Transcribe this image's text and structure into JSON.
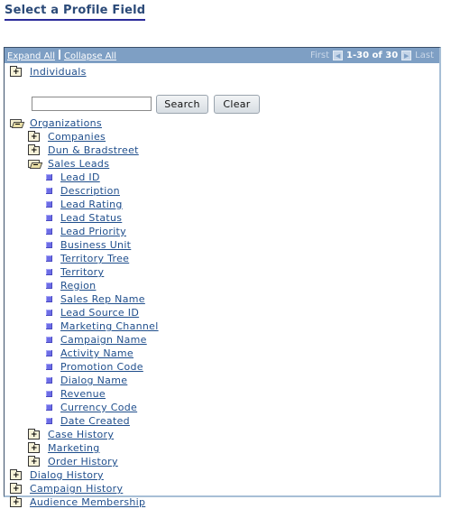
{
  "page": {
    "title": "Select a Profile Field"
  },
  "navbar": {
    "expand_all": "Expand All",
    "collapse_all": "Collapse All",
    "first": "First",
    "last": "Last",
    "count": "1-30 of 30"
  },
  "search": {
    "value": "",
    "placeholder": "",
    "search_label": "Search",
    "clear_label": "Clear"
  },
  "tree": {
    "individuals": "Individuals",
    "organizations": "Organizations",
    "companies": "Companies",
    "dun_bradstreet": "Dun & Bradstreet",
    "sales_leads": "Sales Leads",
    "fields": [
      "Lead ID",
      "Description",
      "Lead Rating",
      "Lead Status",
      "Lead Priority",
      "Business Unit",
      "Territory Tree",
      "Territory",
      "Region",
      "Sales Rep Name",
      "Lead Source ID",
      "Marketing Channel",
      "Campaign Name",
      "Activity Name",
      "Promotion Code",
      "Dialog Name",
      "Revenue",
      "Currency Code",
      "Date Created"
    ],
    "case_history": "Case History",
    "marketing": "Marketing",
    "order_history": "Order History",
    "dialog_history": "Dialog History",
    "campaign_history": "Campaign History",
    "audience_membership": "Audience Membership"
  }
}
